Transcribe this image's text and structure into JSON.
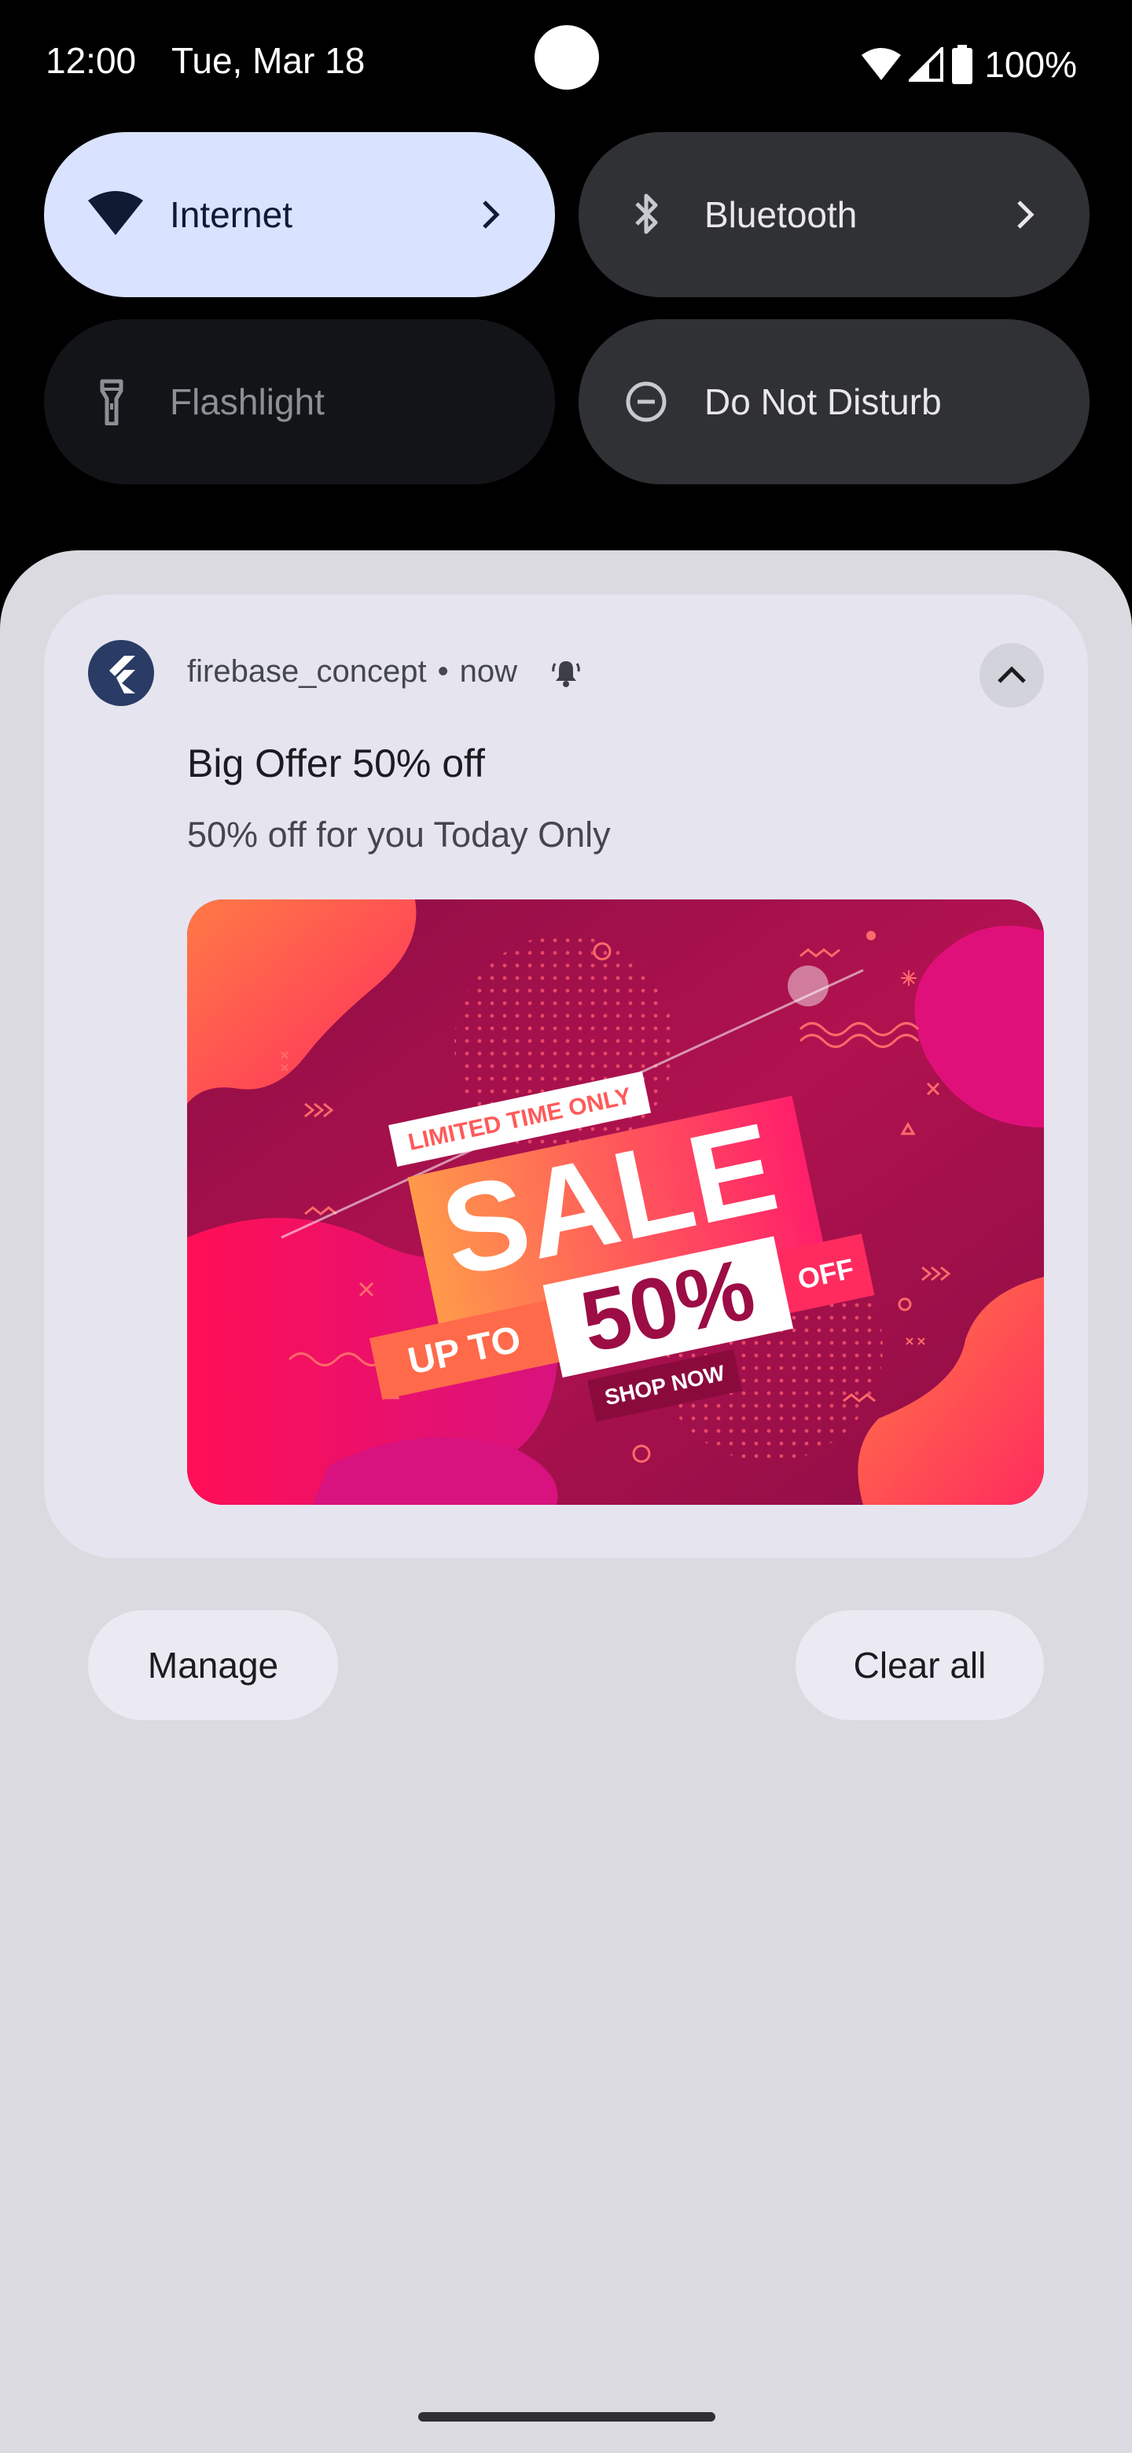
{
  "status_bar": {
    "time": "12:00",
    "date": "Tue, Mar 18",
    "battery": "100%",
    "icons": [
      "wifi-icon",
      "cell-signal-icon",
      "battery-icon"
    ]
  },
  "quick_settings": {
    "tiles": [
      {
        "label": "Internet",
        "icon": "wifi-icon",
        "state": "on",
        "has_chevron": true
      },
      {
        "label": "Bluetooth",
        "icon": "bluetooth-icon",
        "state": "off",
        "has_chevron": true
      },
      {
        "label": "Flashlight",
        "icon": "flashlight-icon",
        "state": "unavailable",
        "has_chevron": false
      },
      {
        "label": "Do Not Disturb",
        "icon": "do-not-disturb-icon",
        "state": "off",
        "has_chevron": false
      }
    ]
  },
  "notification": {
    "app_name": "firebase_concept",
    "separator": "•",
    "time": "now",
    "title": "Big Offer 50% off",
    "body": "50% off for you Today Only",
    "image": {
      "limited": "LIMITED TIME ONLY",
      "sale": "SALE",
      "up_to": "UP TO",
      "percent": "50%",
      "off": "OFF",
      "shop_now": "SHOP NOW"
    }
  },
  "actions": {
    "manage": "Manage",
    "clear_all": "Clear all"
  },
  "colors": {
    "tile_active": "#d9e2ff",
    "tile_inactive": "#303134",
    "shade": "#dadae0",
    "card": "#e6e5ef",
    "promo_magenta": "#a0104a",
    "promo_pink": "#ff1f5a",
    "promo_orange": "#ff8a50"
  }
}
